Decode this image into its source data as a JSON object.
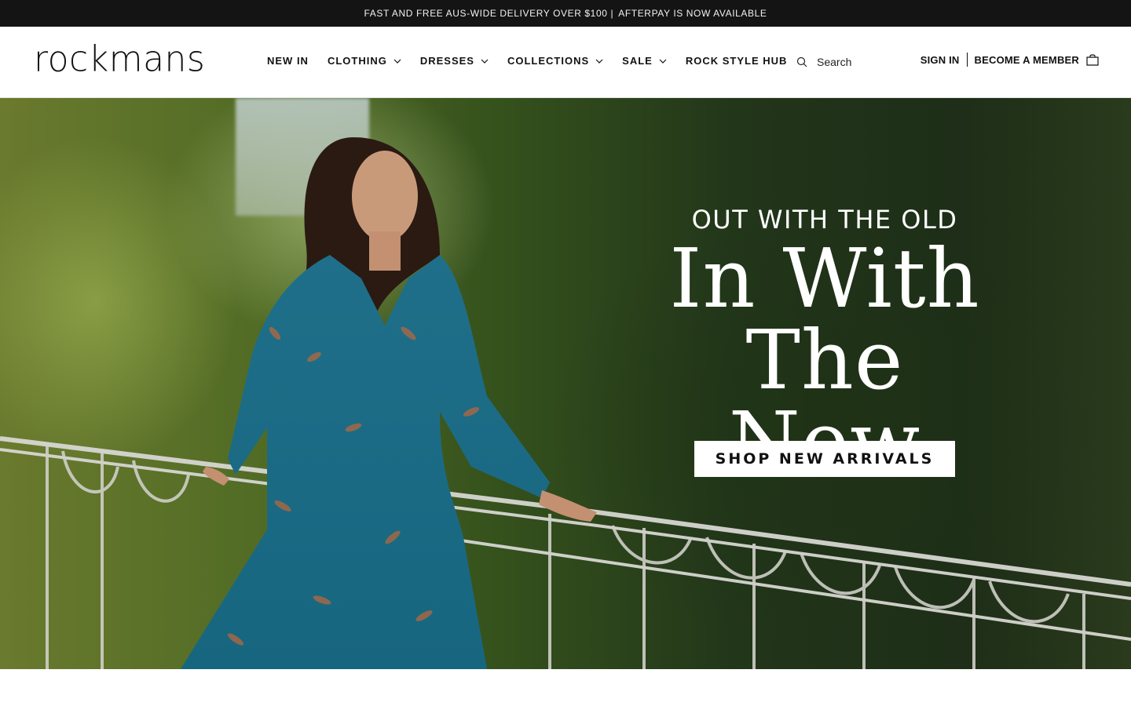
{
  "announcement": {
    "delivery": "FAST AND FREE AUS-WIDE DELIVERY OVER $100",
    "separator": "|",
    "afterpay": "AFTERPAY IS NOW AVAILABLE"
  },
  "header": {
    "logo": "rockmans",
    "nav": [
      {
        "label": "NEW IN",
        "has_dropdown": false
      },
      {
        "label": "CLOTHING",
        "has_dropdown": true
      },
      {
        "label": "DRESSES",
        "has_dropdown": true
      },
      {
        "label": "COLLECTIONS",
        "has_dropdown": true
      },
      {
        "label": "SALE",
        "has_dropdown": true
      },
      {
        "label": "ROCK STYLE HUB",
        "has_dropdown": false
      }
    ],
    "search": {
      "placeholder": "Search",
      "value": "",
      "icon": "search-icon"
    },
    "sign_in": "SIGN IN",
    "become_member": "BECOME A MEMBER",
    "bag_icon": "shopping-bag-icon"
  },
  "hero": {
    "kicker": "OUT WITH THE OLD",
    "line1": "In With",
    "line2": "The New",
    "cta": "SHOP NEW ARRIVALS"
  },
  "colors": {
    "announcement_bg": "#141414",
    "text": "#111111",
    "cta_bg": "#ffffff",
    "hero_text": "#ffffff"
  }
}
